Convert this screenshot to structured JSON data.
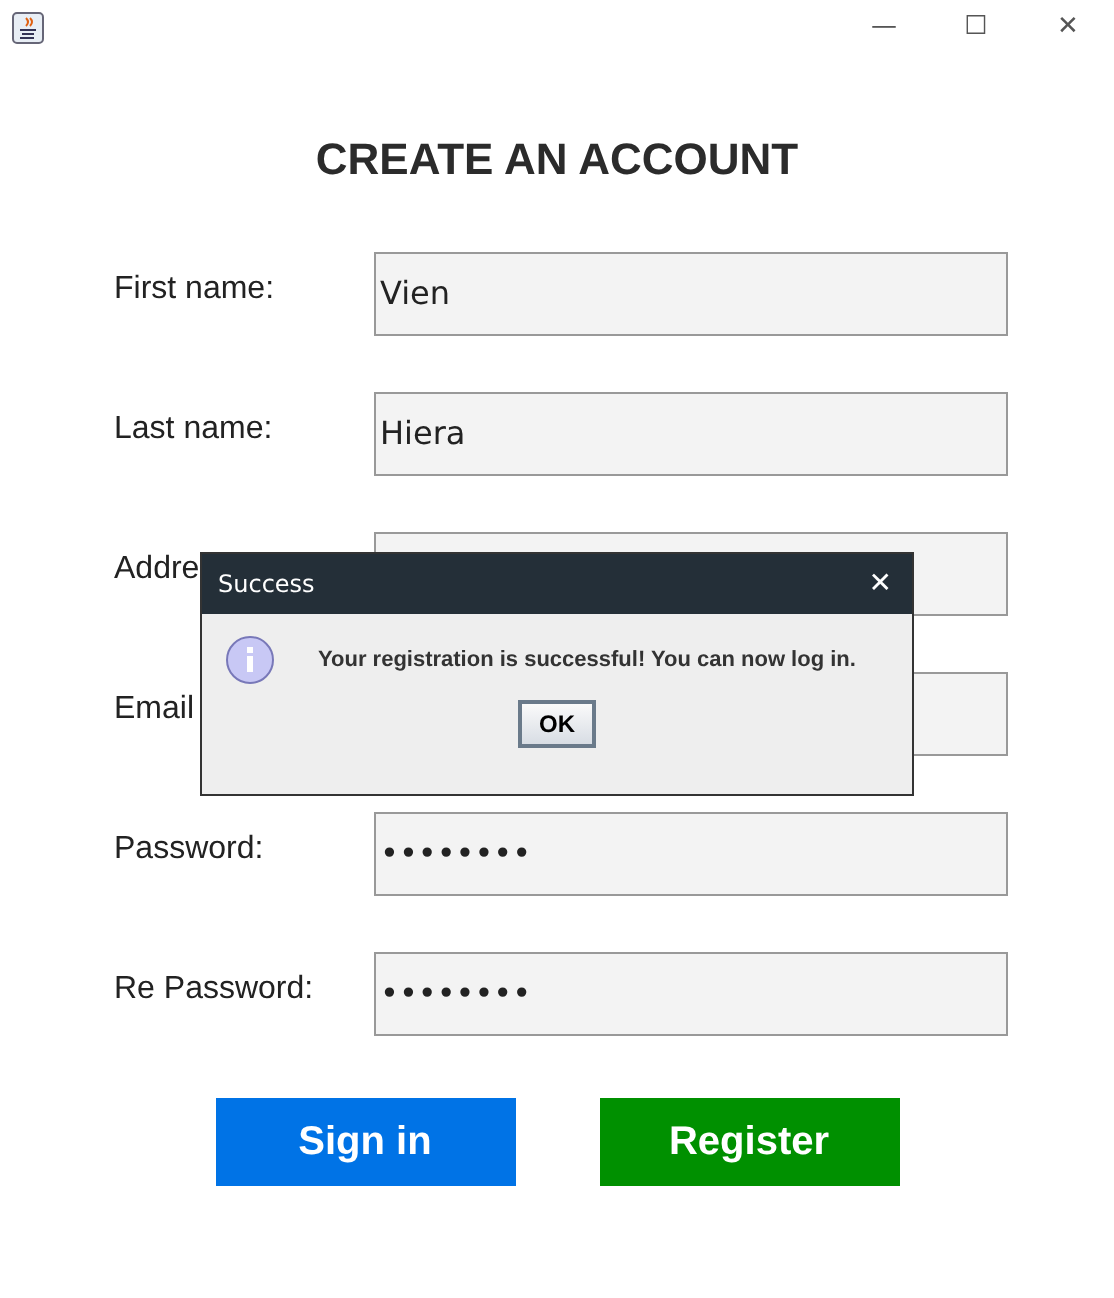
{
  "window": {
    "title_buttons": [
      "—",
      "☐",
      "✕"
    ]
  },
  "heading": "CREATE AN ACCOUNT",
  "fields": [
    {
      "label": "First name:",
      "value": "Vien"
    },
    {
      "label": "Last name:",
      "value": "Hiera"
    },
    {
      "label": "Addre"
    },
    {
      "label": "Email"
    },
    {
      "label": "Password:",
      "value": "••••••••"
    },
    {
      "label": "Re Password:",
      "value": "••••••••"
    }
  ],
  "buttons": [
    {
      "label": "Sign in",
      "color": "#0073e6"
    },
    {
      "label": "Register",
      "color": "#009000"
    }
  ],
  "dialog": {
    "title": "Success",
    "close": "✕",
    "message": "Your registration is successful! You can now log in.",
    "button": "OK"
  }
}
